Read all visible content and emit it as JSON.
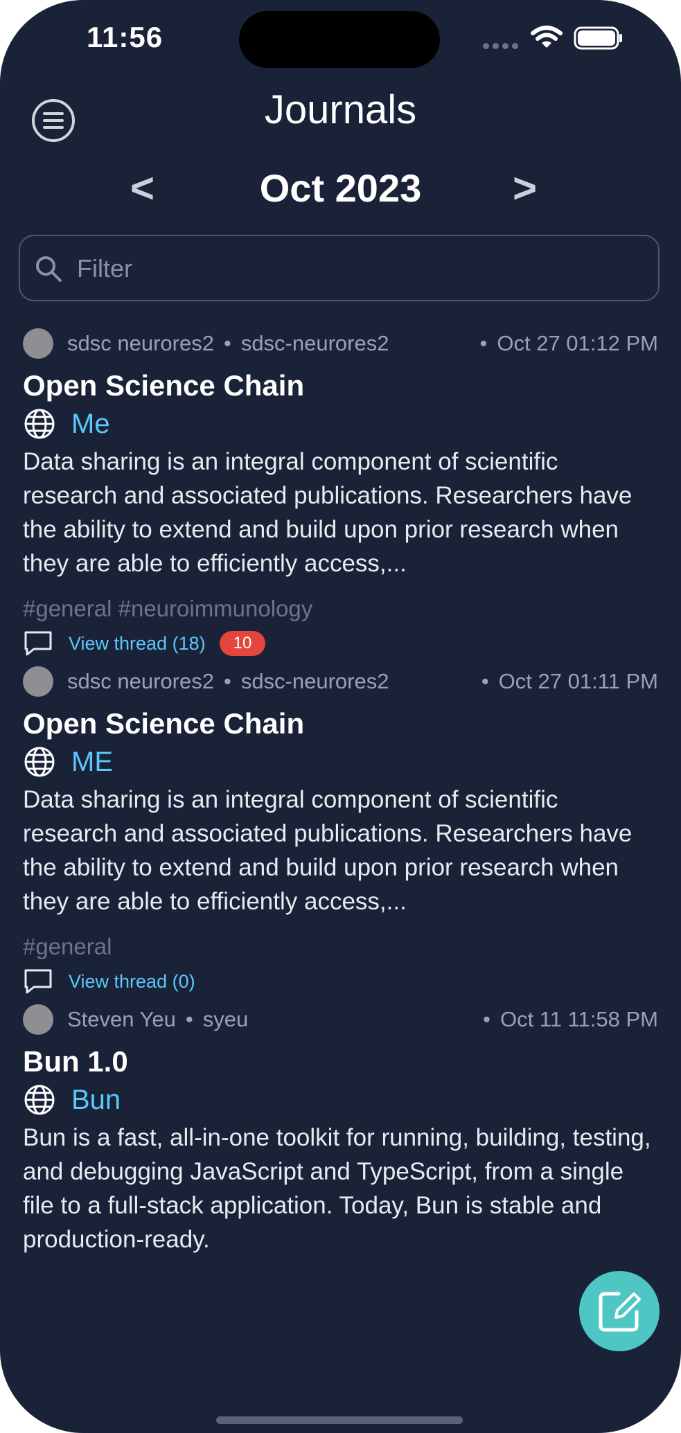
{
  "status_bar": {
    "time": "11:56"
  },
  "header": {
    "title": "Journals",
    "month": "Oct 2023",
    "prev": "<",
    "next": ">"
  },
  "filter": {
    "placeholder": "Filter",
    "value": ""
  },
  "posts": [
    {
      "author": "sdsc neurores2",
      "handle": "sdsc-neurores2",
      "date": "Oct 27 01:12 PM",
      "title": "Open Science Chain",
      "audience": "Me",
      "body": "Data sharing is an integral component of scientific research and associated publications. Researchers have the ability to extend and build upon prior research when they are able to efficiently access,...",
      "tags": "#general #neuroimmunology",
      "thread": "View thread (18)",
      "badge": "10"
    },
    {
      "author": "sdsc neurores2",
      "handle": "sdsc-neurores2",
      "date": "Oct 27 01:11 PM",
      "title": "Open Science Chain",
      "audience": "ME",
      "body": "Data sharing is an integral component of scientific research and associated publications. Researchers have the ability to extend and build upon prior research when they are able to efficiently access,...",
      "tags": "#general",
      "thread": "View thread (0)"
    },
    {
      "author": "Steven Yeu",
      "handle": "syeu",
      "date": "Oct 11 11:58 PM",
      "title": "Bun 1.0",
      "audience": "Bun",
      "body": "Bun is a fast, all-in-one toolkit for running, building, testing, and debugging JavaScript and TypeScript, from a single file to a full-stack application. Today, Bun is stable and production-ready."
    }
  ],
  "icons": {
    "menu": "menu-icon",
    "search": "search-icon",
    "globe": "globe-icon",
    "comment": "comment-bubble-icon",
    "compose": "compose-icon"
  },
  "colors": {
    "background": "#1a2238",
    "accent": "#5ac8fa",
    "badge": "#e5463c",
    "compose": "#4ec6c4"
  }
}
